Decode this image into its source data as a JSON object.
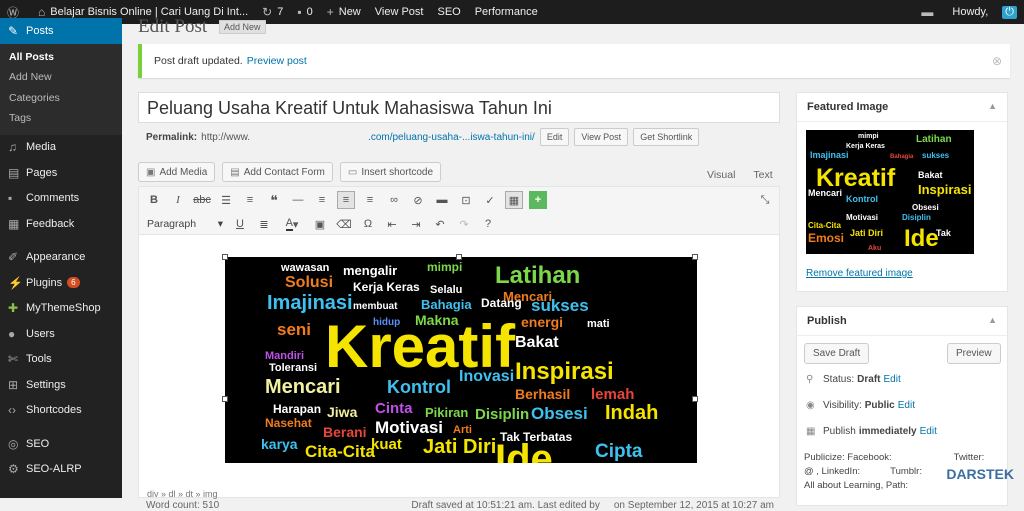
{
  "adminbar": {
    "site": "Belajar Bisnis Online | Cari Uang Di Int...",
    "updates": "7",
    "comments": "0",
    "new": "New",
    "view_post": "View Post",
    "seo": "SEO",
    "performance": "Performance",
    "howdy": "Howdy,"
  },
  "sidebar": {
    "posts": "Posts",
    "sub": [
      "All Posts",
      "Add New",
      "Categories",
      "Tags"
    ],
    "items": [
      "Media",
      "Pages",
      "Comments",
      "Feedback",
      "Appearance",
      "Plugins",
      "MyThemeShop",
      "Users",
      "Tools",
      "Settings",
      "Shortcodes",
      "SEO",
      "SEO-ALRP"
    ],
    "plugins_badge": "6"
  },
  "page": {
    "title": "Edit Post",
    "add_new": "Add New"
  },
  "notice": {
    "text": "Post draft updated.",
    "link": "Preview post"
  },
  "post": {
    "title": "Peluang Usaha Kreatif Untuk Mahasiswa Tahun Ini",
    "permalink_label": "Permalink:",
    "permalink_base": "http://www.",
    "permalink_slug": ".com/peluang-usaha-...iswa-tahun-ini/",
    "edit": "Edit",
    "view": "View Post",
    "shortlink": "Get Shortlink"
  },
  "media_buttons": {
    "add_media": "Add Media",
    "add_contact_form": "Add Contact Form",
    "insert_shortcode": "Insert shortcode"
  },
  "editor_tabs": {
    "visual": "Visual",
    "text": "Text"
  },
  "toolbar": {
    "format": "Paragraph"
  },
  "editor": {
    "path": "div » dl » dt » img",
    "word_count": "Word count: 510",
    "saved": "Draft saved at 10:51:21 am. Last edited by",
    "edited_on": "on September 12, 2015 at 10:27 am"
  },
  "wordcloud": [
    "wawasan",
    "mengalir",
    "mimpi",
    "Latihan",
    "Solusi",
    "Kerja Keras",
    "Selalu",
    "Mencari",
    "Imajinasi",
    "membuat",
    "Bahagia",
    "Datang",
    "sukses",
    "hidup",
    "energi",
    "mati",
    "seni",
    "Makna",
    "Kreatif",
    "Bakat",
    "Mandiri",
    "Toleransi",
    "Inspirasi",
    "Inovasi",
    "Mencari",
    "Kontrol",
    "Berhasil",
    "lemah",
    "Harapan",
    "Jiwa",
    "Cinta",
    "Pikiran",
    "Disiplin",
    "Obsesi",
    "Indah",
    "Nasehat",
    "Berani",
    "Motivasi",
    "Arti",
    "karya",
    "Cita-Cita",
    "kuat",
    "Jati Diri",
    "Tak",
    "Terbatas",
    "Cipta",
    "Ide"
  ],
  "featured": {
    "title": "Featured Image",
    "remove": "Remove featured image",
    "words": [
      "mimpi",
      "Latihan",
      "Kerja Keras",
      "Bahagia",
      "Imajinasi",
      "sukses",
      "Kreatif",
      "Bakat",
      "Mencari",
      "Inspirasi",
      "Kontrol",
      "Obsesi",
      "Motivasi",
      "Disiplin",
      "Cita-Cita",
      "Jati Diri",
      "Emosi",
      "Ide",
      "Aku",
      "Tak"
    ]
  },
  "publish": {
    "title": "Publish",
    "save_draft": "Save Draft",
    "preview": "Preview",
    "status_label": "Status:",
    "status_value": "Draft",
    "visibility_label": "Visibility:",
    "visibility_value": "Public",
    "schedule_label": "Publish",
    "schedule_value": "immediately",
    "edit": "Edit",
    "publicize": "Publicize: Facebook:",
    "twitter": "Twitter:",
    "linkedin": "@  , LinkedIn:",
    "tumblr": "Tumblr:",
    "path": "All about Learning, Path:"
  },
  "watermark": "DARSTEK"
}
